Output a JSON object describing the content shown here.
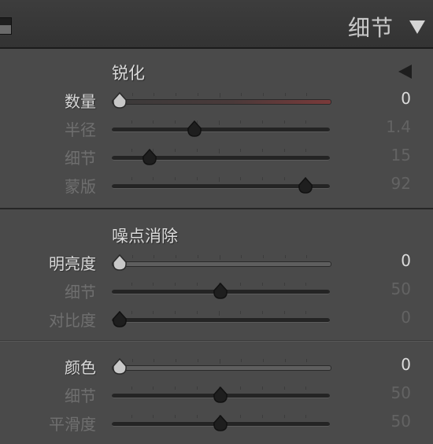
{
  "panel": {
    "title": "细节",
    "colors": {
      "background": "#4a4a4a",
      "header": "#363636",
      "active_text": "#d8d8d8",
      "dim_text": "#6f6f6f",
      "amount_track_accent": "#7a3a3a"
    },
    "icons": {
      "collapse": "panel-collapse-icon",
      "expand": "triangle-down-icon",
      "preview": "triangle-left-icon"
    }
  },
  "sharpening": {
    "title": "锐化",
    "sliders": [
      {
        "label": "数量",
        "value": "0",
        "level": 0,
        "active": true
      },
      {
        "label": "半径",
        "value": "1.4",
        "level": 0.37,
        "active": false
      },
      {
        "label": "细节",
        "value": "15",
        "level": 0.15,
        "active": false
      },
      {
        "label": "蒙版",
        "value": "92",
        "level": 0.92,
        "active": false
      }
    ]
  },
  "noise_reduction": {
    "title": "噪点消除",
    "sliders": [
      {
        "label": "明亮度",
        "value": "0",
        "level": 0,
        "active": true
      },
      {
        "label": "细节",
        "value": "50",
        "level": 0.5,
        "active": false
      },
      {
        "label": "对比度",
        "value": "0",
        "level": 0,
        "active": false
      }
    ],
    "color_sliders": [
      {
        "label": "颜色",
        "value": "0",
        "level": 0,
        "active": true
      },
      {
        "label": "细节",
        "value": "50",
        "level": 0.5,
        "active": false
      },
      {
        "label": "平滑度",
        "value": "50",
        "level": 0.5,
        "active": false
      }
    ]
  }
}
